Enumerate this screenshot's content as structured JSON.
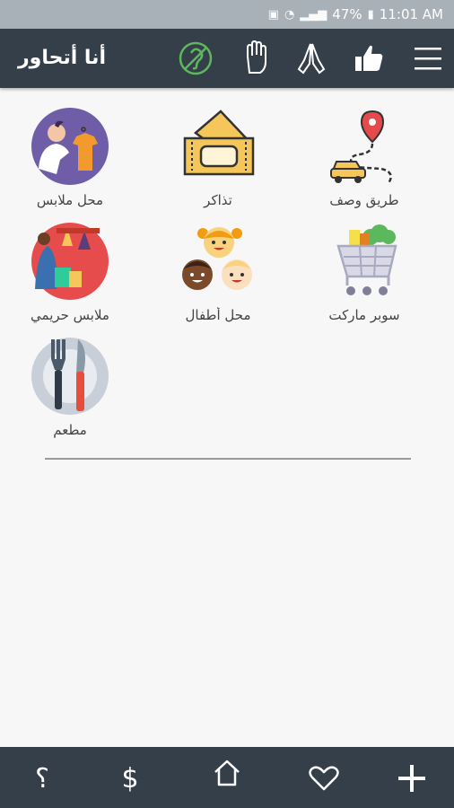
{
  "status_bar": {
    "battery": "47%",
    "time": "11:01 AM"
  },
  "app_bar": {
    "title": "أنا أتحاور",
    "icons": [
      "menu-icon",
      "thumbs-up-icon",
      "praying-hands-icon",
      "raised-hand-icon",
      "deaf-ear-icon"
    ]
  },
  "categories": [
    {
      "label": "محل ملابس",
      "icon": "clothing-shop-icon"
    },
    {
      "label": "تذاكر",
      "icon": "tickets-icon"
    },
    {
      "label": "طريق وصف",
      "icon": "directions-car-icon"
    },
    {
      "label": "ملابس حريمي",
      "icon": "women-clothing-icon"
    },
    {
      "label": "محل أطفال",
      "icon": "kids-shop-icon"
    },
    {
      "label": "سوبر ماركت",
      "icon": "supermarket-cart-icon"
    },
    {
      "label": "مطعم",
      "icon": "restaurant-icon"
    }
  ],
  "bottom_bar": {
    "items": [
      {
        "label": "؟",
        "icon": "question-icon"
      },
      {
        "label": "$",
        "icon": "dollar-icon"
      },
      {
        "label": "",
        "icon": "home-icon"
      },
      {
        "label": "",
        "icon": "heart-icon"
      },
      {
        "label": "",
        "icon": "plus-icon"
      }
    ]
  },
  "colors": {
    "bar": "#353f4a",
    "status_bar": "#a8b0b8",
    "background": "#f7f7f7",
    "accent_green": "#5cb85c"
  }
}
